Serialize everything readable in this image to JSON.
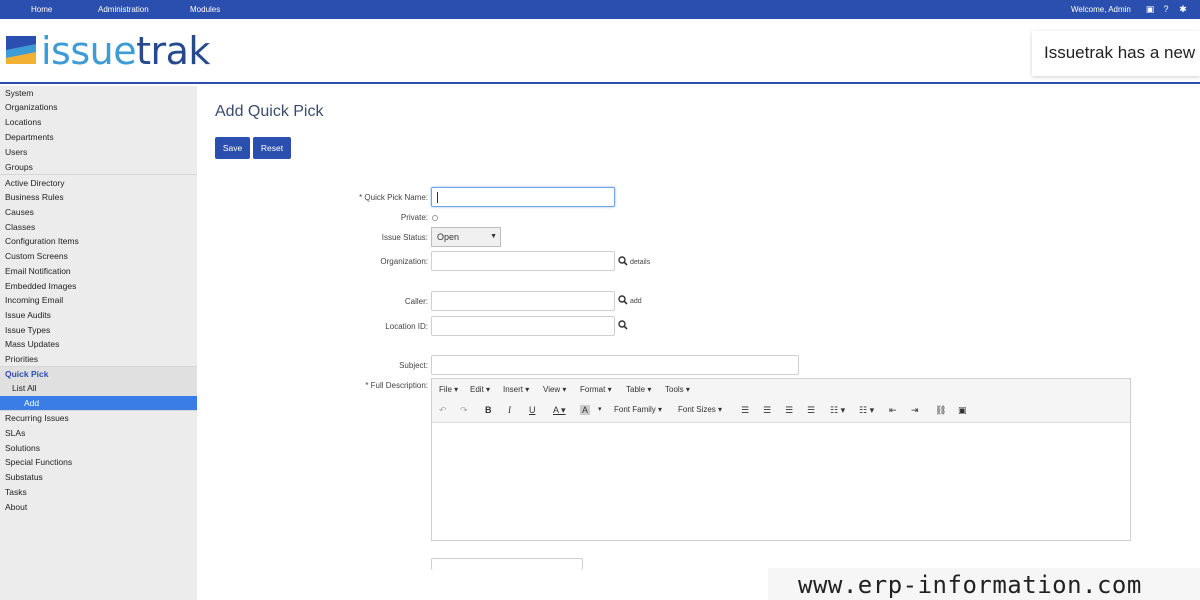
{
  "topnav": {
    "home": "Home",
    "administration": "Administration",
    "modules": "Modules",
    "welcome": "Welcome, Admin"
  },
  "brand": {
    "logo_part1": "issue",
    "logo_part2": "trak"
  },
  "toast": {
    "text": "Issuetrak has a new"
  },
  "sidebar": {
    "items": [
      "System",
      "Organizations",
      "Locations",
      "Departments",
      "Users",
      "Groups",
      "Active Directory",
      "Business Rules",
      "Causes",
      "Classes",
      "Configuration Items",
      "Custom Screens",
      "Email Notification",
      "Embedded Images",
      "Incoming Email",
      "Issue Audits",
      "Issue Types",
      "Mass Updates",
      "Priorities",
      "Quick Pick",
      "List All",
      "Add",
      "Recurring Issues",
      "SLAs",
      "Solutions",
      "Special Functions",
      "Substatus",
      "Tasks",
      "About"
    ]
  },
  "page": {
    "title": "Add Quick Pick"
  },
  "buttons": {
    "save": "Save",
    "reset": "Reset"
  },
  "form": {
    "quick_pick_name_label": "* Quick Pick Name:",
    "private_label": "Private:",
    "issue_status_label": "Issue Status:",
    "issue_status_value": "Open",
    "organization_label": "Organization:",
    "organization_link": "details",
    "caller_label": "Caller:",
    "caller_link": "add",
    "location_label": "Location ID:",
    "subject_label": "Subject:",
    "description_label": "* Full Description:"
  },
  "editor": {
    "menus": [
      "File",
      "Edit",
      "Insert",
      "View",
      "Format",
      "Table",
      "Tools"
    ],
    "font_family": "Font Family",
    "font_sizes": "Font Sizes"
  },
  "watermark": "www.erp-information.com"
}
